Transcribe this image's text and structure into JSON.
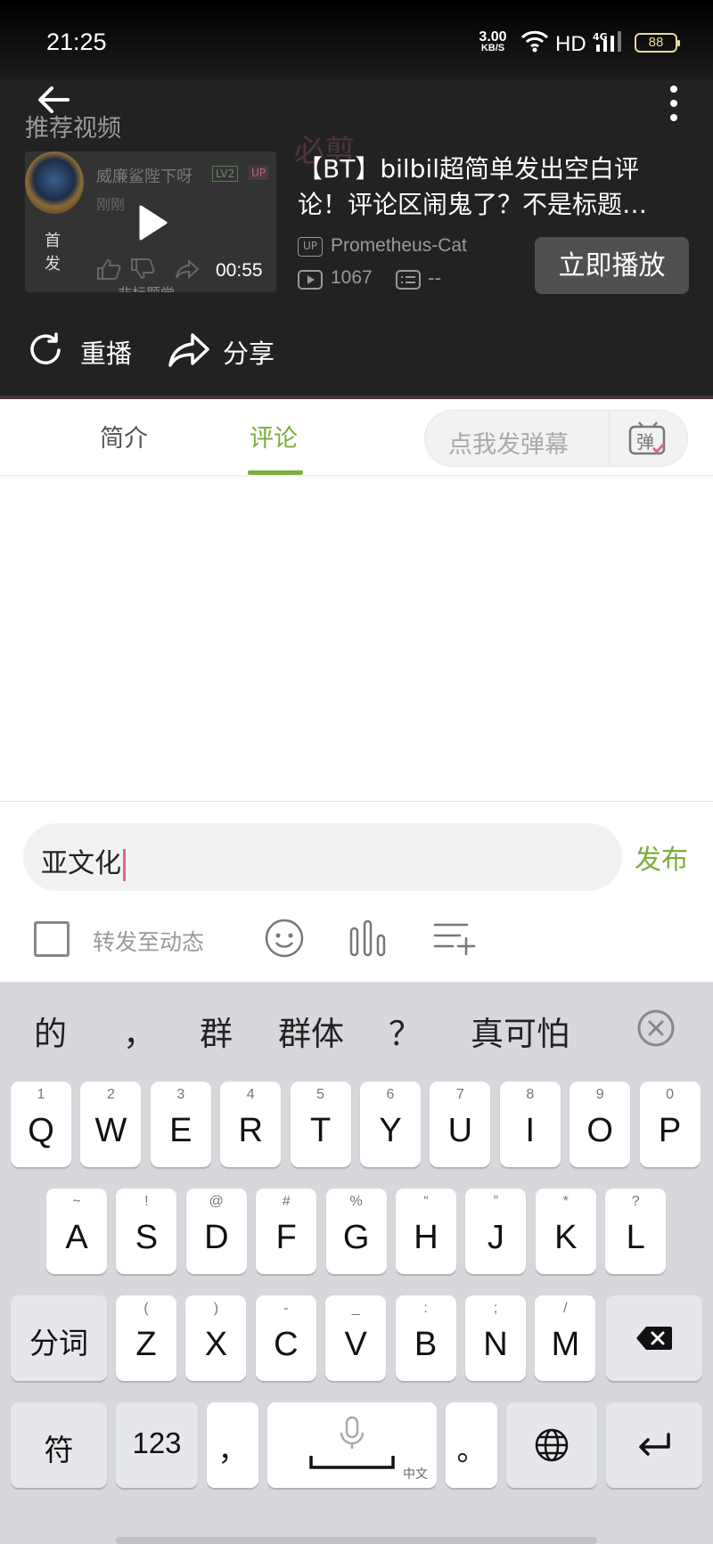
{
  "status": {
    "time": "21:25",
    "net_speed_value": "3.00",
    "net_speed_unit": "KB/S",
    "hd": "HD",
    "signal": "4G",
    "battery": "88"
  },
  "header": {
    "recommend_title": "推荐视频",
    "watermark": "必剪"
  },
  "thumbnail": {
    "uploader": "威廉鲨陛下呀",
    "level": "LV2",
    "up_badge": "UP",
    "ago": "刚刚",
    "first_label": "首发",
    "duration": "00:55",
    "subtitle": "非标题党"
  },
  "video": {
    "title_line1": "【BT】bilbil超简单发出空白评",
    "title_line2": "论！评论区闹鬼了？不是标题…",
    "up_tag": "UP",
    "up_name": "Prometheus-Cat",
    "views": "1067",
    "danmaku_count": "--",
    "play_now": "立即播放"
  },
  "actions": {
    "replay": "重播",
    "share": "分享"
  },
  "tabs": {
    "intro": "简介",
    "comments": "评论",
    "danmaku_placeholder": "点我发弹幕"
  },
  "compose": {
    "input_value": "亚文化",
    "publish": "发布",
    "forward_label": "转发至动态"
  },
  "keyboard": {
    "candidates": [
      "的",
      "，",
      "群",
      "群体",
      "？",
      "真可怕"
    ],
    "row1": [
      {
        "k": "Q",
        "h": "1"
      },
      {
        "k": "W",
        "h": "2"
      },
      {
        "k": "E",
        "h": "3"
      },
      {
        "k": "R",
        "h": "4"
      },
      {
        "k": "T",
        "h": "5"
      },
      {
        "k": "Y",
        "h": "6"
      },
      {
        "k": "U",
        "h": "7"
      },
      {
        "k": "I",
        "h": "8"
      },
      {
        "k": "O",
        "h": "9"
      },
      {
        "k": "P",
        "h": "0"
      }
    ],
    "row2": [
      {
        "k": "A",
        "h": "~"
      },
      {
        "k": "S",
        "h": "!"
      },
      {
        "k": "D",
        "h": "@"
      },
      {
        "k": "F",
        "h": "#"
      },
      {
        "k": "G",
        "h": "%"
      },
      {
        "k": "H",
        "h": "“"
      },
      {
        "k": "J",
        "h": "”"
      },
      {
        "k": "K",
        "h": "*"
      },
      {
        "k": "L",
        "h": "?"
      }
    ],
    "row3": [
      {
        "k": "Z",
        "h": "("
      },
      {
        "k": "X",
        "h": ")"
      },
      {
        "k": "C",
        "h": "-"
      },
      {
        "k": "V",
        "h": "_"
      },
      {
        "k": "B",
        "h": ":"
      },
      {
        "k": "N",
        "h": ";"
      },
      {
        "k": "M",
        "h": "/"
      }
    ],
    "segment": "分词",
    "symbols": "符",
    "numbers": "123",
    "comma": "，",
    "space_lang": "中文",
    "period": "。"
  },
  "colors": {
    "accent": "#7cad3e",
    "caret": "#e3658a"
  }
}
